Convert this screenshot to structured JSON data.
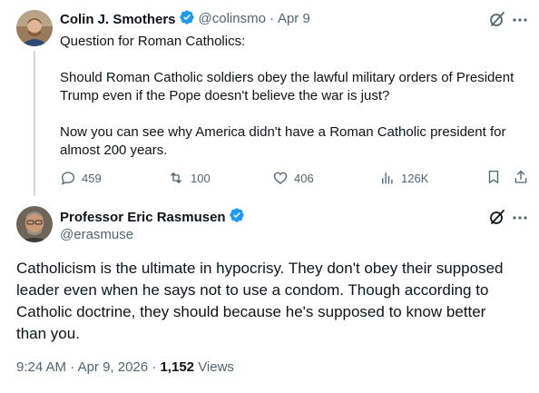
{
  "tweet1": {
    "author_name": "Colin J. Smothers",
    "handle": "@colinsmo",
    "separator": "·",
    "date": "Apr 9",
    "lines": [
      "Question for Roman Catholics:",
      "Should Roman Catholic soldiers obey the lawful military orders of President",
      "Trump even if the Pope doesn't believe the war is just?",
      "Now you can see why America didn't have a Roman Catholic president for",
      "almost 200 years."
    ],
    "stats": {
      "replies": "459",
      "reposts": "100",
      "likes": "406",
      "views": "126K"
    }
  },
  "tweet2": {
    "author_name": "Professor Eric Rasmusen",
    "handle": "@erasmuse",
    "lines": [
      "Catholicism is the ultimate in hypocrisy. They don't obey their supposed",
      "leader even when he says not to use a condom.  Though according to",
      "Catholic doctrine, they should because he's supposed to know better",
      "than you."
    ],
    "time": "9:24 AM",
    "date_sep": "·",
    "date": "Apr 9, 2026",
    "date_sep2": "·",
    "views_count": "1,152",
    "views_label": "Views"
  },
  "icons": {
    "verified": "verified-badge-icon",
    "grok": "grok-icon",
    "more": "more-icon",
    "reply": "reply-icon",
    "repost": "repost-icon",
    "like": "like-icon",
    "views": "views-icon",
    "bookmark": "bookmark-icon",
    "share": "share-icon"
  },
  "colors": {
    "verified": "#1d9bf0",
    "muted": "#536471",
    "text": "#0f1419",
    "thread_line": "#cfd9de"
  }
}
